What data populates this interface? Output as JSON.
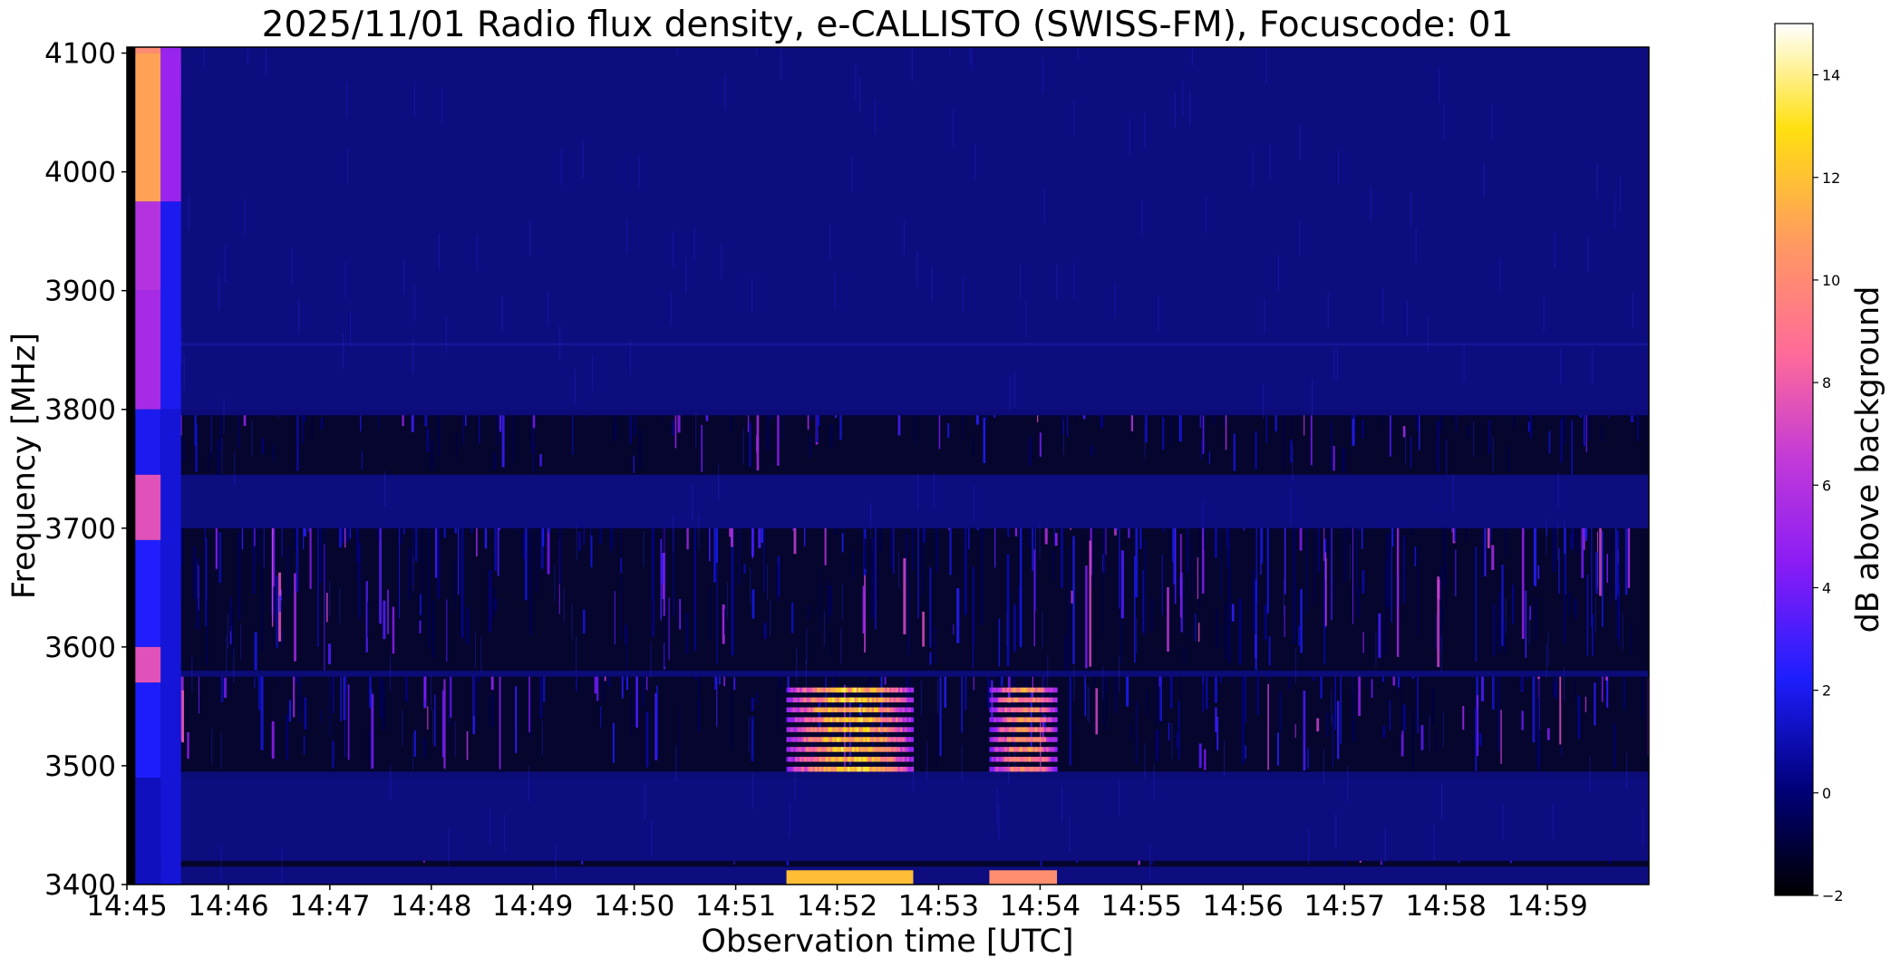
{
  "chart_data": {
    "type": "heatmap",
    "title": "2025/11/01  Radio flux density, e-CALLISTO (SWISS-FM), Focuscode: 01",
    "xlabel": "Observation time [UTC]",
    "ylabel": "Frequency [MHz]",
    "colorbar_label": "dB above background",
    "colormap": "gnuplot2",
    "x_ticks": [
      "14:45",
      "14:46",
      "14:47",
      "14:48",
      "14:49",
      "14:50",
      "14:51",
      "14:52",
      "14:53",
      "14:54",
      "14:55",
      "14:56",
      "14:57",
      "14:58",
      "14:59"
    ],
    "y_ticks": [
      3400,
      3500,
      3600,
      3700,
      3800,
      3900,
      4000,
      4100
    ],
    "colorbar_ticks": [
      -2,
      0,
      2,
      4,
      6,
      8,
      10,
      12,
      14
    ],
    "xlim": [
      "14:45",
      "15:00"
    ],
    "ylim": [
      3400,
      4105
    ],
    "clim": [
      -2,
      15
    ],
    "features": {
      "quiet_bands_MHz": [
        [
          3400,
          3415
        ],
        [
          3420,
          3490
        ],
        [
          3700,
          3745
        ],
        [
          3800,
          4105
        ]
      ],
      "rfi_bands_MHz": [
        [
          3415,
          3420
        ],
        [
          3495,
          3575
        ],
        [
          3580,
          3700
        ],
        [
          3745,
          3795
        ]
      ],
      "bursts": [
        {
          "time_start": "14:51:30",
          "time_end": "14:52:45",
          "freq_MHz": [
            3495,
            3570
          ],
          "peak_dB": 14
        },
        {
          "time_start": "14:53:30",
          "time_end": "14:54:10",
          "freq_MHz": [
            3495,
            3570
          ],
          "peak_dB": 12
        }
      ],
      "calibration_column": {
        "time_start": "14:45:05",
        "time_end": "14:45:20",
        "peak_dB": 11
      }
    }
  }
}
